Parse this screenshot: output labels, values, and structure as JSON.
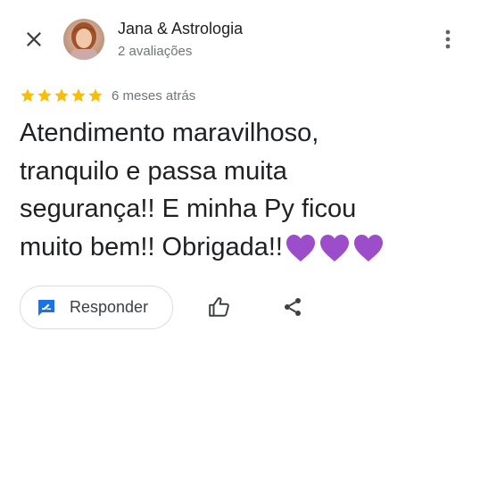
{
  "header": {
    "author_name": "Jana & Astrologia",
    "review_count": "2 avaliações",
    "close_icon": "close-icon",
    "more_icon": "more-vert-icon"
  },
  "review": {
    "rating": 5,
    "rating_max": 5,
    "time_ago": "6 meses atrás",
    "text_lines": [
      "Atendimento maravilhoso,",
      "tranquilo e passa muita",
      "segurança!! E minha Py ficou",
      "muito bem!! Obrigada!!"
    ],
    "trailing_emoji": "💜💜💜"
  },
  "actions": {
    "reply_label": "Responder",
    "reply_icon": "reply-icon",
    "like_icon": "thumb-up-icon",
    "share_icon": "share-icon"
  },
  "colors": {
    "star": "#fbbc04",
    "heart": "#9b4dca",
    "reply_icon": "#1a73e8",
    "text": "#202124",
    "secondary_text": "#70757a",
    "border": "#dadce0"
  }
}
